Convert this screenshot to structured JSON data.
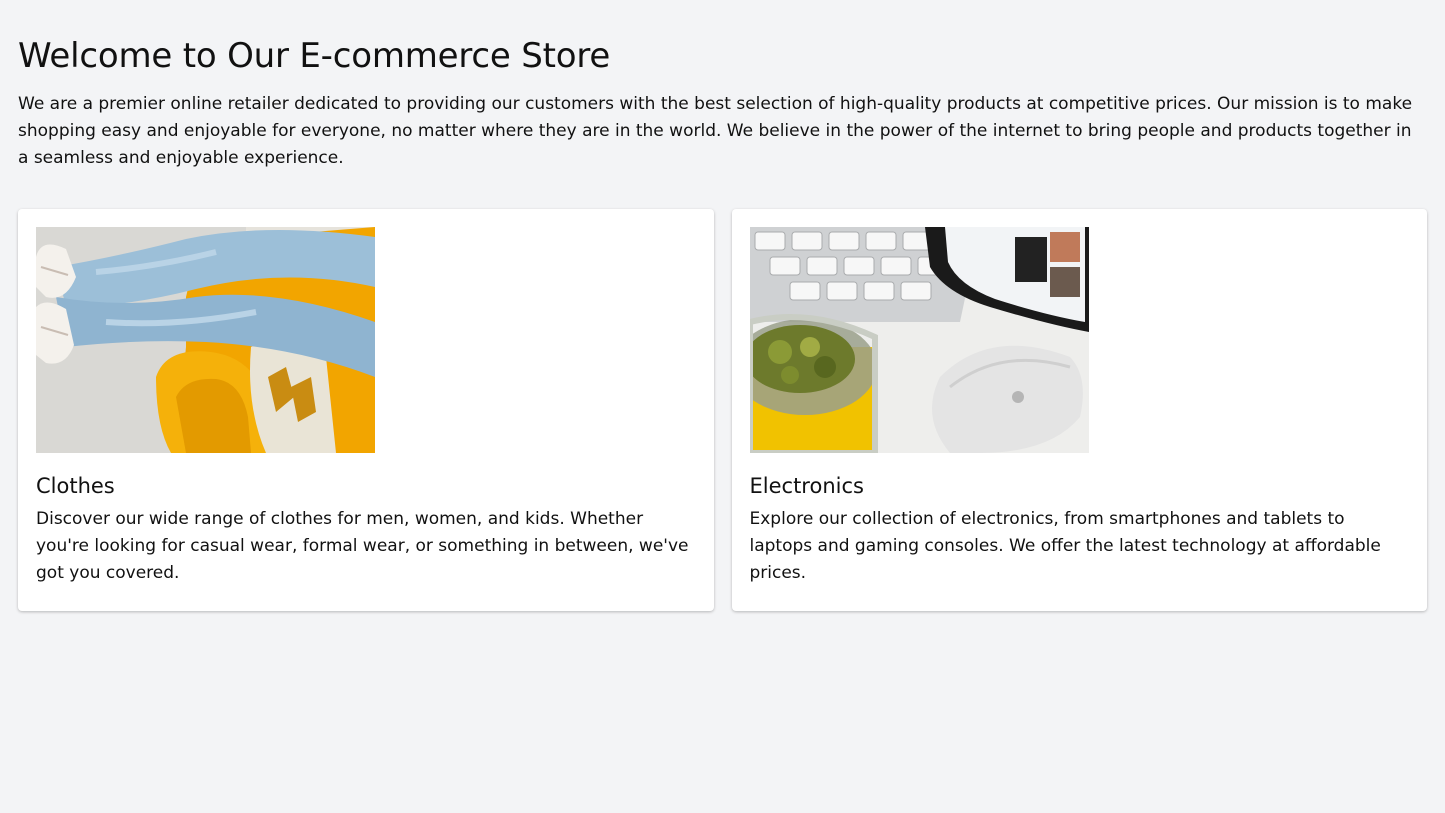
{
  "header": {
    "title": "Welcome to Our E-commerce Store",
    "intro": "We are a premier online retailer dedicated to providing our customers with the best selection of high-quality products at competitive prices. Our mission is to make shopping easy and enjoyable for everyone, no matter where they are in the world. We believe in the power of the internet to bring people and products together in a seamless and enjoyable experience."
  },
  "categories": [
    {
      "image": "clothes-photo",
      "title": "Clothes",
      "description": "Discover our wide range of clothes for men, women, and kids. Whether you're looking for casual wear, formal wear, or something in between, we've got you covered."
    },
    {
      "image": "electronics-photo",
      "title": "Electronics",
      "description": "Explore our collection of electronics, from smartphones and tablets to laptops and gaming consoles. We offer the latest technology at affordable prices."
    }
  ],
  "colors": {
    "background": "#f3f4f6",
    "card": "#ffffff",
    "text": "#111111"
  }
}
